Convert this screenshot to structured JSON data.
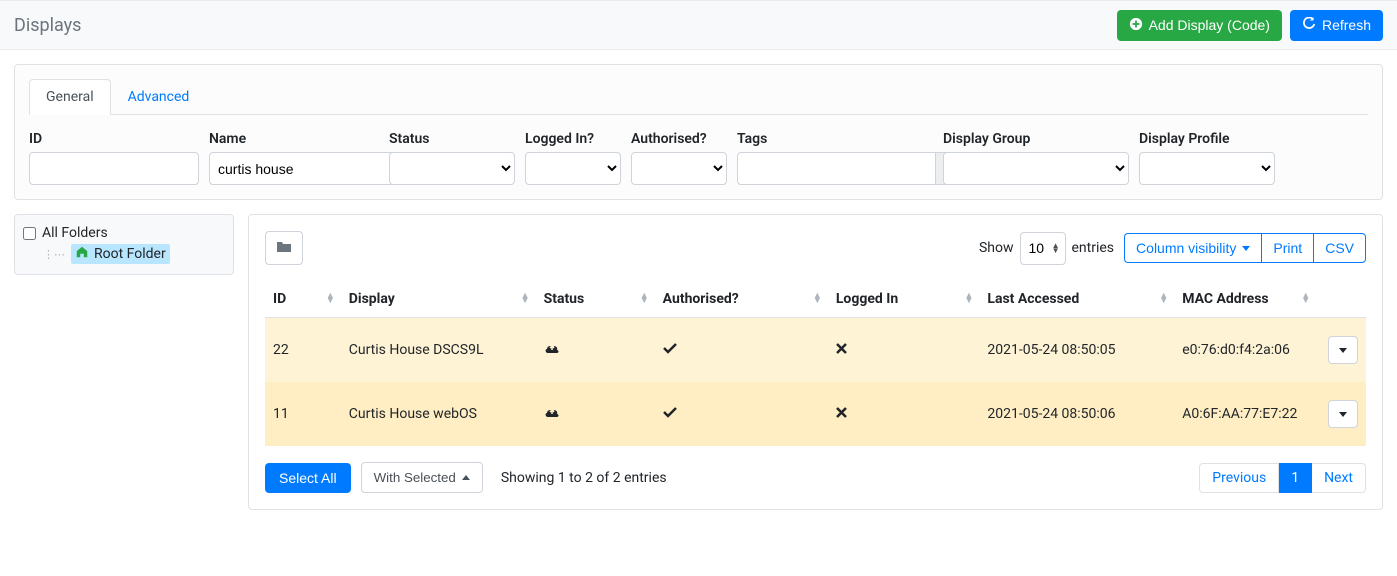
{
  "header": {
    "title": "Displays",
    "add_label": "Add Display (Code)",
    "refresh_label": "Refresh"
  },
  "tabs": {
    "general": "General",
    "advanced": "Advanced"
  },
  "filters": {
    "labels": {
      "id": "ID",
      "name": "Name",
      "status": "Status",
      "loggedin": "Logged In?",
      "authorised": "Authorised?",
      "tags": "Tags",
      "group": "Display Group",
      "profile": "Display Profile"
    },
    "name_value": "curtis house"
  },
  "tree": {
    "all": "All Folders",
    "root": "Root Folder"
  },
  "grid": {
    "show_prefix": "Show",
    "show_suffix": "entries",
    "page_size": "10",
    "colvis": "Column visibility",
    "print": "Print",
    "csv": "CSV",
    "columns": {
      "id": "ID",
      "display": "Display",
      "status": "Status",
      "authorised": "Authorised?",
      "loggedin": "Logged In",
      "lastaccessed": "Last Accessed",
      "mac": "MAC Address"
    },
    "rows": [
      {
        "id": "22",
        "display": "Curtis House DSCS9L",
        "lastaccessed": "2021-05-24 08:50:05",
        "mac": "e0:76:d0:f4:2a:06"
      },
      {
        "id": "11",
        "display": "Curtis House webOS",
        "lastaccessed": "2021-05-24 08:50:06",
        "mac": "A0:6F:AA:77:E7:22"
      }
    ],
    "select_all": "Select All",
    "with_selected": "With Selected",
    "info": "Showing 1 to 2 of 2 entries",
    "prev": "Previous",
    "page": "1",
    "next": "Next"
  }
}
